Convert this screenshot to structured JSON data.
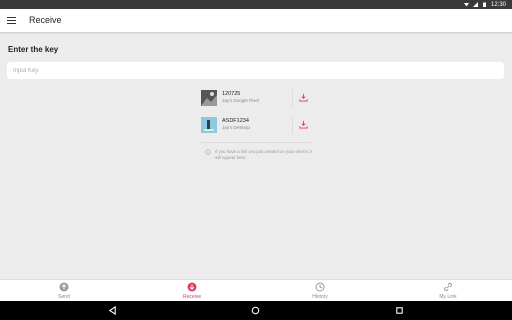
{
  "status_bar": {
    "time": "12:30"
  },
  "app_bar": {
    "title": "Receive",
    "menu_icon": "menu-icon"
  },
  "section": {
    "title": "Enter the key"
  },
  "key_input": {
    "placeholder": "Input Key",
    "value": ""
  },
  "devices": [
    {
      "name": "120725",
      "subtitle": "Jay's Google Pixel",
      "icon": "download-icon"
    },
    {
      "name": "ASDF1234",
      "subtitle": "Jay's Desktop",
      "icon": "download-icon"
    }
  ],
  "info": {
    "text": "If you have a link you just created on your device, it will appear here.",
    "icon": "info-icon"
  },
  "bottom_nav": [
    {
      "label": "Send",
      "icon": "upload-icon"
    },
    {
      "label": "Receive",
      "icon": "download-icon"
    },
    {
      "label": "History",
      "icon": "clock-icon"
    },
    {
      "label": "My Link",
      "icon": "link-icon"
    }
  ],
  "colors": {
    "accent": "#e33b5c",
    "background": "#ececec"
  }
}
